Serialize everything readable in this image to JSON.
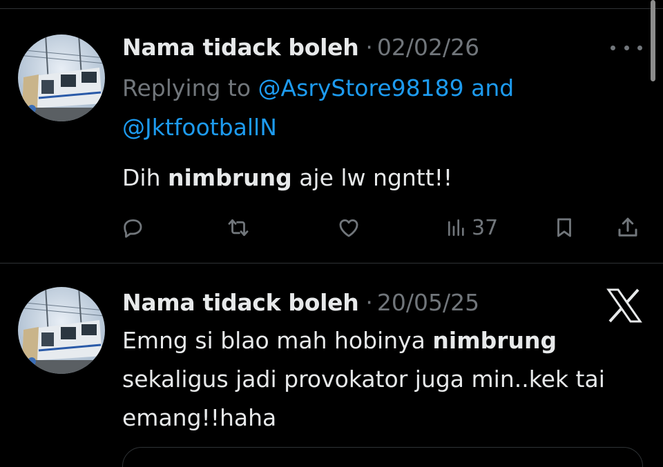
{
  "tweets": [
    {
      "author": "Nama tidack boleh",
      "separator": "·",
      "date": "02/02/26",
      "replying_prefix": "Replying to",
      "mention_1": "@AsryStore98189",
      "conjunction": "and",
      "mention_2": "@JktfootballN",
      "text_before": "Dih",
      "text_bold": "nimbrung",
      "text_after": "aje lw ngntt!!",
      "views": "37"
    },
    {
      "author": "Nama tidack boleh",
      "separator": "·",
      "date": "20/05/25",
      "text_before": "Emng si blao mah hobinya",
      "text_bold": "nimbrung",
      "text_after": "sekaligus jadi provokator juga min..kek tai emang!!haha"
    }
  ],
  "icons": {
    "more": "more-horizontal-icon",
    "reply": "reply-icon",
    "retweet": "retweet-icon",
    "like": "like-icon",
    "views": "views-icon",
    "bookmark": "bookmark-icon",
    "share": "share-icon",
    "x_logo": "x-logo-icon"
  },
  "colors": {
    "background": "#000000",
    "text": "#e7e9ea",
    "muted": "#71767b",
    "accent": "#1d9bf0",
    "divider": "#2f3336"
  }
}
